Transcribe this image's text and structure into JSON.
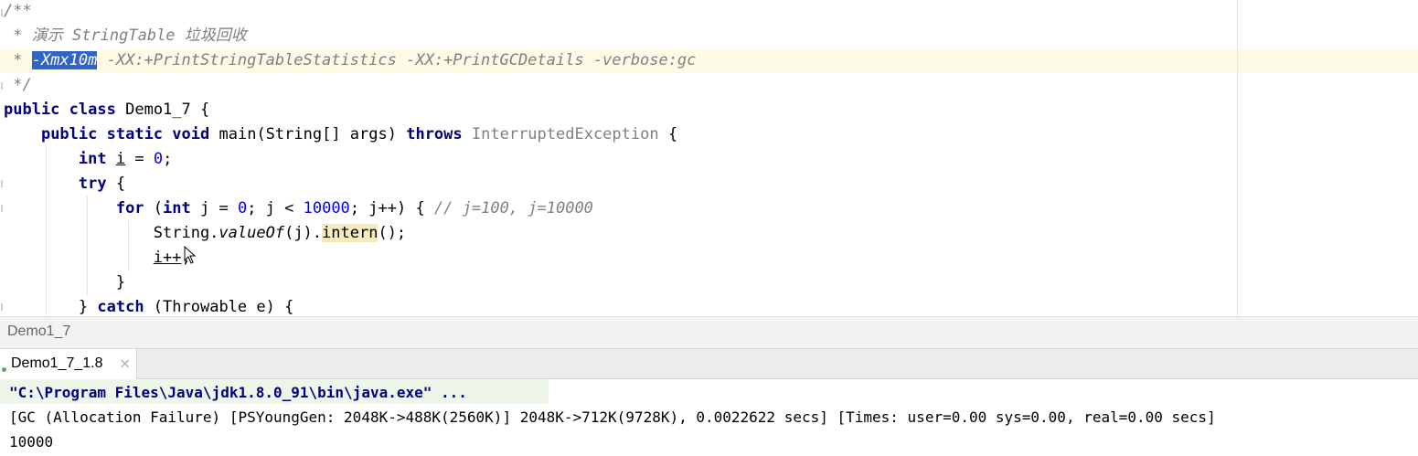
{
  "editor": {
    "code": {
      "l1": "/**",
      "l2_star": " * ",
      "l2_text": "演示 StringTable 垃圾回收",
      "l3_star": " * ",
      "l3_selected": "-Xmx10m",
      "l3_rest": " -XX:+PrintStringTableStatistics -XX:+PrintGCDetails -verbose:gc",
      "l4": " */",
      "l5_kw1": "public",
      "l5_kw2": "class",
      "l5_name": "Demo1_7 {",
      "l6_kw1": "public",
      "l6_kw2": "static",
      "l6_kw3": "void",
      "l6_sig": "main(String[] args)",
      "l6_kw4": "throws",
      "l6_exc": "InterruptedException",
      "l6_brace": "{",
      "l7_kw": "int",
      "l7_var": "i",
      "l7_eq": " = ",
      "l7_num": "0",
      "l7_end": ";",
      "l8_kw": "try",
      "l8_brace": " {",
      "l9_kw": "for",
      "l9_a": " (",
      "l9_kw2": "int",
      "l9_b": " j = ",
      "l9_num1": "0",
      "l9_c": "; j < ",
      "l9_num2": "10000",
      "l9_d": "; j++) { ",
      "l9_cmt": "// j=100, j=10000",
      "l10_a": "String.",
      "l10_static": "valueOf",
      "l10_b": "(j).",
      "l10_call": "intern",
      "l10_c": "();",
      "l11_var": "i++",
      "l11_end": ";",
      "l12": "}",
      "l13_a": "} ",
      "l13_kw": "catch",
      "l13_b": " (Throwable e) {"
    }
  },
  "breadcrumb": {
    "label": "Demo1_7"
  },
  "run_tab": {
    "label": "Demo1_7_1.8",
    "close_glyph": "×"
  },
  "console": {
    "line1": "\"C:\\Program Files\\Java\\jdk1.8.0_91\\bin\\java.exe\" ...",
    "line2": "[GC (Allocation Failure) [PSYoungGen: 2048K->488K(2560K)] 2048K->712K(9728K), 0.0022622 secs] [Times: user=0.00 sys=0.00, real=0.00 secs]",
    "line3": "10000"
  },
  "colors": {
    "keyword": "#000080",
    "number": "#0000ff",
    "comment": "#808080",
    "selection": "#2f65ca",
    "current_line": "#fdfae6"
  }
}
